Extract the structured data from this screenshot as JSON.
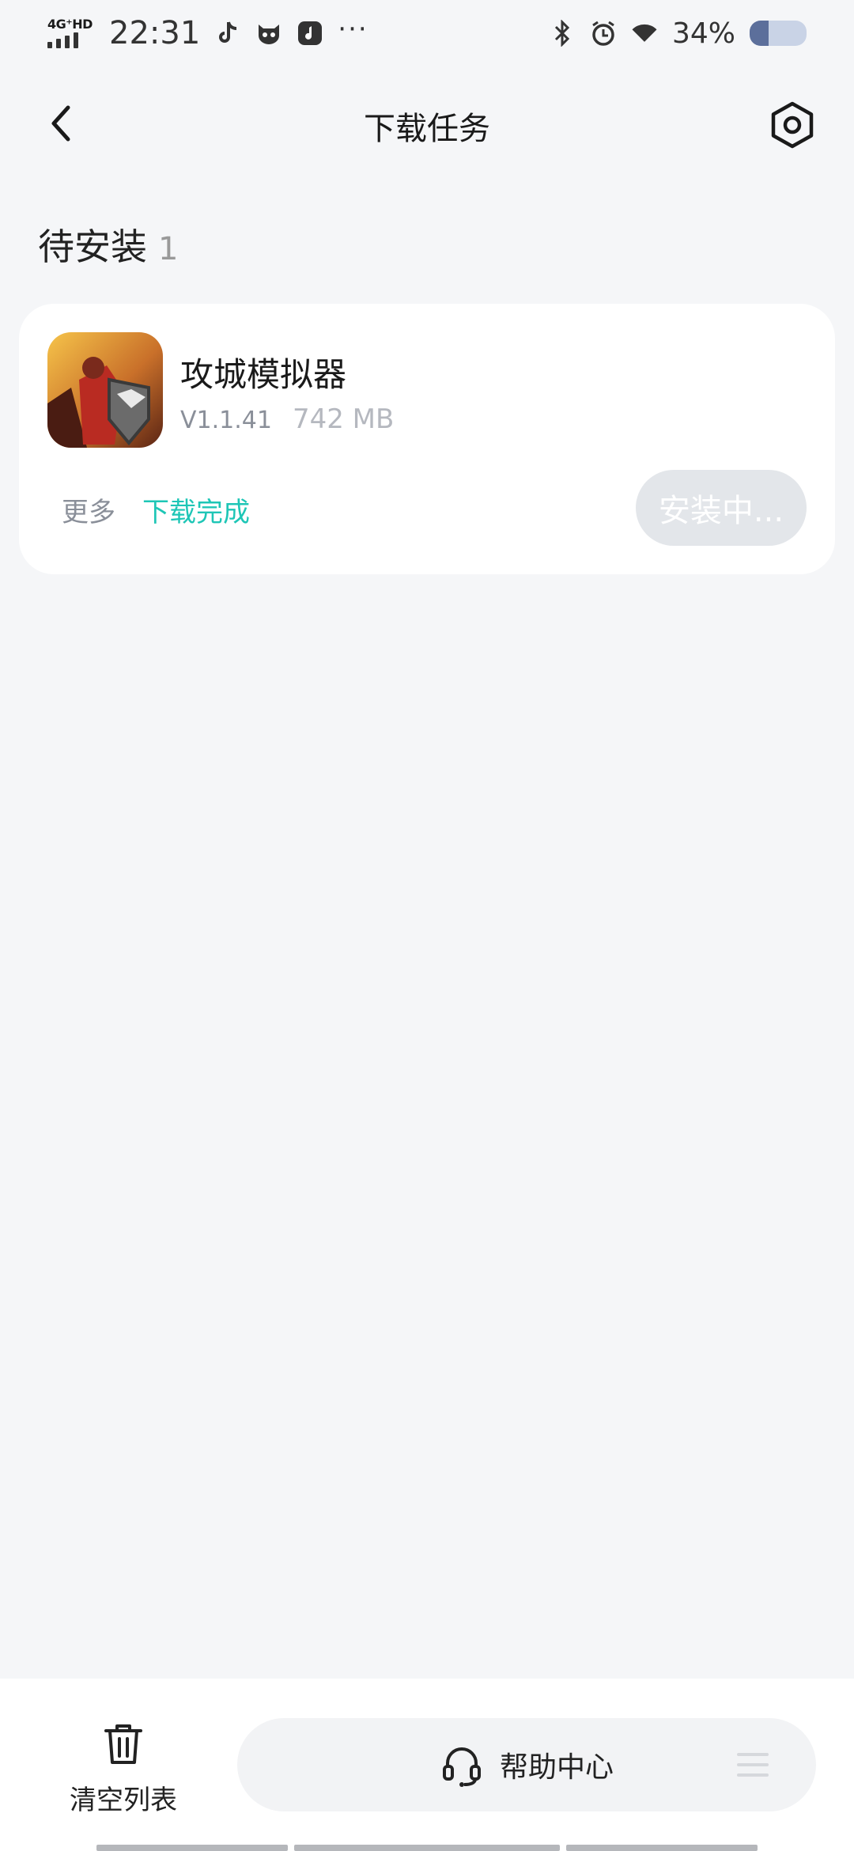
{
  "status_bar": {
    "network": "4G⁺HD",
    "time": "22:31",
    "battery": "34%",
    "icons": [
      "tiktok-icon",
      "cat-face-icon",
      "music-note-icon",
      "more-dots-icon",
      "bluetooth-icon",
      "alarm-icon",
      "wifi-icon",
      "battery-icon"
    ]
  },
  "header": {
    "title": "下载任务"
  },
  "section": {
    "title": "待安装",
    "count": "1"
  },
  "task": {
    "app_name": "攻城模拟器",
    "version": "V1.1.41",
    "size": "742 MB",
    "more_label": "更多",
    "status_label": "下载完成",
    "install_label": "安装中..."
  },
  "bottom": {
    "clear_label": "清空列表",
    "help_label": "帮助中心"
  },
  "colors": {
    "accent": "#1ec6b6",
    "background": "#f5f6f8",
    "button_disabled": "#e3e6ea"
  }
}
